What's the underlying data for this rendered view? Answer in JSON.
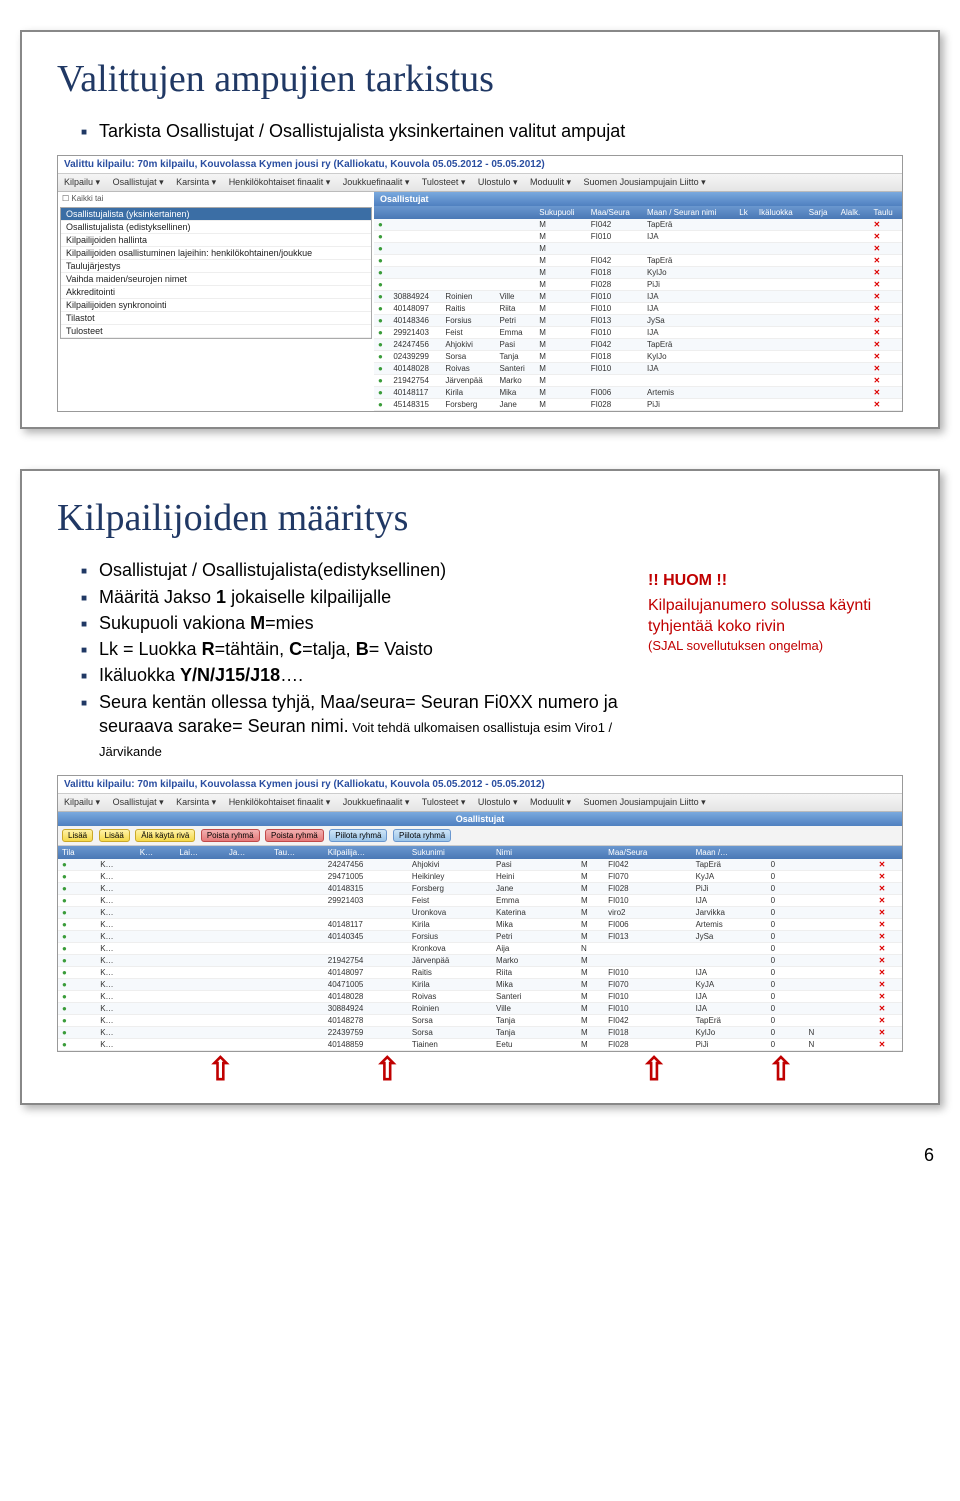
{
  "slide1": {
    "title": "Valittujen ampujien tarkistus",
    "bullet": "Tarkista Osallistujat / Osallistujalista yksinkertainen valitut ampujat",
    "ss_header": "Valittu kilpailu: 70m kilpailu, Kouvolassa Kymen jousi ry (Kalliokatu, Kouvola 05.05.2012 - 05.05.2012)",
    "menu": [
      "Kilpailu ▾",
      "Osallistujat ▾",
      "Karsinta ▾",
      "Henkilökohtaiset finaalit ▾",
      "Joukkuefinaalit ▾",
      "Tulosteet ▾",
      "Ulostulo ▾",
      "Moduulit ▾",
      "Suomen Jousiampujain Liitto ▾"
    ],
    "tabtitle": "Osallistujat",
    "dropdown": [
      "Osallistujalista (yksinkertainen)",
      "Osallistujalista (edistyksellinen)",
      "Kilpailijoiden hallinta",
      "Kilpailijoiden osallistuminen lajeihin: henkilökohtainen/joukkue",
      "Taulujärjestys",
      "Vaihda maiden/seurojen nimet",
      "Akkreditointi",
      "Kilpailijoiden synkronointi",
      "Tilastot",
      "Tulosteet"
    ],
    "cols": [
      "",
      "",
      "",
      "",
      "Sukupuoli",
      "Maa/Seura",
      "Maan / Seuran nimi",
      "Lk",
      "Ikäluokka",
      "Sarja",
      "Alalk.",
      "Taulu"
    ],
    "rows": [
      [
        "",
        "",
        "",
        "",
        "M",
        "FI042",
        "TapErä",
        "",
        "",
        "",
        "",
        ""
      ],
      [
        "",
        "",
        "",
        "",
        "M",
        "FI010",
        "IJA",
        "",
        "",
        "",
        "",
        ""
      ],
      [
        "",
        "",
        "",
        "",
        "M",
        "",
        "",
        "",
        "",
        "",
        "",
        ""
      ],
      [
        "",
        "",
        "",
        "",
        "M",
        "FI042",
        "TapErä",
        "",
        "",
        "",
        "",
        ""
      ],
      [
        "",
        "",
        "",
        "",
        "M",
        "FI018",
        "KylJo",
        "",
        "",
        "",
        "",
        ""
      ],
      [
        "",
        "",
        "",
        "",
        "M",
        "FI028",
        "PiJi",
        "",
        "",
        "",
        "",
        ""
      ],
      [
        "",
        "30884924",
        "Roinien",
        "Ville",
        "M",
        "FI010",
        "IJA",
        "",
        "",
        "",
        "",
        ""
      ],
      [
        "",
        "40148097",
        "Raitis",
        "Riita",
        "M",
        "FI010",
        "IJA",
        "",
        "",
        "",
        "",
        ""
      ],
      [
        "",
        "40148346",
        "Forsius",
        "Petri",
        "M",
        "FI013",
        "JySa",
        "",
        "",
        "",
        "",
        ""
      ],
      [
        "",
        "29921403",
        "Feist",
        "Emma",
        "M",
        "FI010",
        "IJA",
        "",
        "",
        "",
        "",
        ""
      ],
      [
        "",
        "24247456",
        "Ahjokivi",
        "Pasi",
        "M",
        "FI042",
        "TapErä",
        "",
        "",
        "",
        "",
        ""
      ],
      [
        "",
        "02439299",
        "Sorsa",
        "Tanja",
        "M",
        "FI018",
        "KylJo",
        "",
        "",
        "",
        "",
        ""
      ],
      [
        "",
        "40148028",
        "Roivas",
        "Santeri",
        "M",
        "FI010",
        "IJA",
        "",
        "",
        "",
        "",
        ""
      ],
      [
        "",
        "21942754",
        "Järvenpää",
        "Marko",
        "M",
        "",
        "",
        "",
        "",
        "",
        "",
        ""
      ],
      [
        "",
        "40148117",
        "Kirila",
        "Mika",
        "M",
        "FI006",
        "Artemis",
        "",
        "",
        "",
        "",
        ""
      ],
      [
        "",
        "45148315",
        "Forsberg",
        "Jane",
        "M",
        "FI028",
        "PiJi",
        "",
        "",
        "",
        "",
        ""
      ]
    ]
  },
  "slide2": {
    "title": "Kilpailijoiden määritys",
    "bullets": [
      "Osallistujat / Osallistujalista(edistyksellinen)",
      "Määritä Jakso 1 jokaiselle kilpailijalle",
      "Sukupuoli vakiona M=mies",
      "Lk = Luokka R=tähtäin, C=talja, B= Vaisto",
      "Ikäluokka Y/N/J15/J18….",
      "Seura kentän ollessa tyhjä, Maa/seura= Seuran Fi0XX numero ja seuraava sarake= Seuran nimi."
    ],
    "bullet_tail": " Voit tehdä ulkomaisen osallistuja esim Viro1 / Järvikande",
    "note_title": "!! HUOM !!",
    "note_body": "Kilpailujanumero solussa käynti tyhjentää koko rivin",
    "note_sub": "(SJAL sovellutuksen ongelma)",
    "ss_header": "Valittu kilpailu: 70m kilpailu, Kouvolassa Kymen jousi ry (Kalliokatu, Kouvola 05.05.2012 - 05.05.2012)",
    "menu": [
      "Kilpailu ▾",
      "Osallistujat ▾",
      "Karsinta ▾",
      "Henkilökohtaiset finaalit ▾",
      "Joukkuefinaalit ▾",
      "Tulosteet ▾",
      "Ulostulo ▾",
      "Moduulit ▾",
      "Suomen Jousiampujain Liitto ▾"
    ],
    "tabtitle": "Osallistujat",
    "btn_row": [
      "Lisää",
      "Lisää",
      "Älä käytä rivä",
      "Poista ryhmä",
      "Poista ryhmä",
      "Piilota ryhmä",
      "Piilota ryhmä"
    ],
    "cols2": [
      "Tila",
      "",
      "K…",
      "Lai…",
      "Ja…",
      "Tau…",
      "Kilpailija…",
      "Sukunimi",
      "Nimi",
      "",
      "",
      "Maa/Seura",
      "Maan /…",
      "",
      "",
      "",
      "",
      "",
      "",
      ""
    ],
    "rows2": [
      [
        "",
        "K…",
        "",
        "",
        "",
        "",
        "24247456",
        "Ahjokivi",
        "Pasi",
        "",
        "M",
        "FI042",
        "TapErä",
        "0",
        "",
        "",
        "",
        "",
        "",
        ""
      ],
      [
        "",
        "K…",
        "",
        "",
        "",
        "",
        "29471005",
        "Heikinley",
        "Heini",
        "",
        "M",
        "FI070",
        "KyJA",
        "0",
        "",
        "",
        "",
        "",
        "",
        ""
      ],
      [
        "",
        "K…",
        "",
        "",
        "",
        "",
        "40148315",
        "Forsberg",
        "Jane",
        "",
        "M",
        "FI028",
        "PiJi",
        "0",
        "",
        "",
        "",
        "",
        "",
        ""
      ],
      [
        "",
        "K…",
        "",
        "",
        "",
        "",
        "29921403",
        "Feist",
        "Emma",
        "",
        "M",
        "FI010",
        "IJA",
        "0",
        "",
        "",
        "",
        "",
        "",
        ""
      ],
      [
        "",
        "K…",
        "",
        "",
        "",
        "",
        "",
        "Uronkova",
        "Katerina",
        "",
        "M",
        "viro2",
        "Jarvikka",
        "0",
        "",
        "",
        "",
        "",
        "",
        ""
      ],
      [
        "",
        "K…",
        "",
        "",
        "",
        "",
        "40148117",
        "Kirila",
        "Mika",
        "",
        "M",
        "FI006",
        "Artemis",
        "0",
        "",
        "",
        "",
        "",
        "",
        ""
      ],
      [
        "",
        "K…",
        "",
        "",
        "",
        "",
        "40140345",
        "Forsius",
        "Petri",
        "",
        "M",
        "FI013",
        "JySa",
        "0",
        "",
        "",
        "",
        "",
        "",
        ""
      ],
      [
        "",
        "K…",
        "",
        "",
        "",
        "",
        "",
        "Kronkova",
        "Aija",
        "",
        "N",
        "",
        "",
        "0",
        "",
        "",
        "",
        "",
        "",
        ""
      ],
      [
        "",
        "K…",
        "",
        "",
        "",
        "",
        "21942754",
        "Järvenpää",
        "Marko",
        "",
        "M",
        "",
        "",
        "0",
        "",
        "",
        "",
        "",
        "",
        ""
      ],
      [
        "",
        "K…",
        "",
        "",
        "",
        "",
        "40148097",
        "Raitis",
        "Riita",
        "",
        "M",
        "FI010",
        "IJA",
        "0",
        "",
        "",
        "",
        "",
        "",
        ""
      ],
      [
        "",
        "K…",
        "",
        "",
        "",
        "",
        "40471005",
        "Kirila",
        "Mika",
        "",
        "M",
        "FI070",
        "KyJA",
        "0",
        "",
        "",
        "",
        "",
        "",
        ""
      ],
      [
        "",
        "K…",
        "",
        "",
        "",
        "",
        "40148028",
        "Roivas",
        "Santeri",
        "",
        "M",
        "FI010",
        "IJA",
        "0",
        "",
        "",
        "",
        "",
        "",
        ""
      ],
      [
        "",
        "K…",
        "",
        "",
        "",
        "",
        "30884924",
        "Roinien",
        "Ville",
        "",
        "M",
        "FI010",
        "IJA",
        "0",
        "",
        "",
        "",
        "",
        "",
        ""
      ],
      [
        "",
        "K…",
        "",
        "",
        "",
        "",
        "40148278",
        "Sorsa",
        "Tanja",
        "",
        "M",
        "FI042",
        "TapErä",
        "0",
        "",
        "",
        "",
        "",
        "",
        ""
      ],
      [
        "",
        "K…",
        "",
        "",
        "",
        "",
        "22439759",
        "Sorsa",
        "Tanja",
        "",
        "M",
        "FI018",
        "KylJo",
        "0",
        "",
        "N",
        "",
        "",
        "",
        ""
      ],
      [
        "",
        "K…",
        "",
        "",
        "",
        "",
        "40148859",
        "Tiainen",
        "Eetu",
        "",
        "M",
        "FI028",
        "PiJi",
        "0",
        "",
        "N",
        "",
        "",
        "",
        ""
      ]
    ]
  },
  "page_number": "6"
}
